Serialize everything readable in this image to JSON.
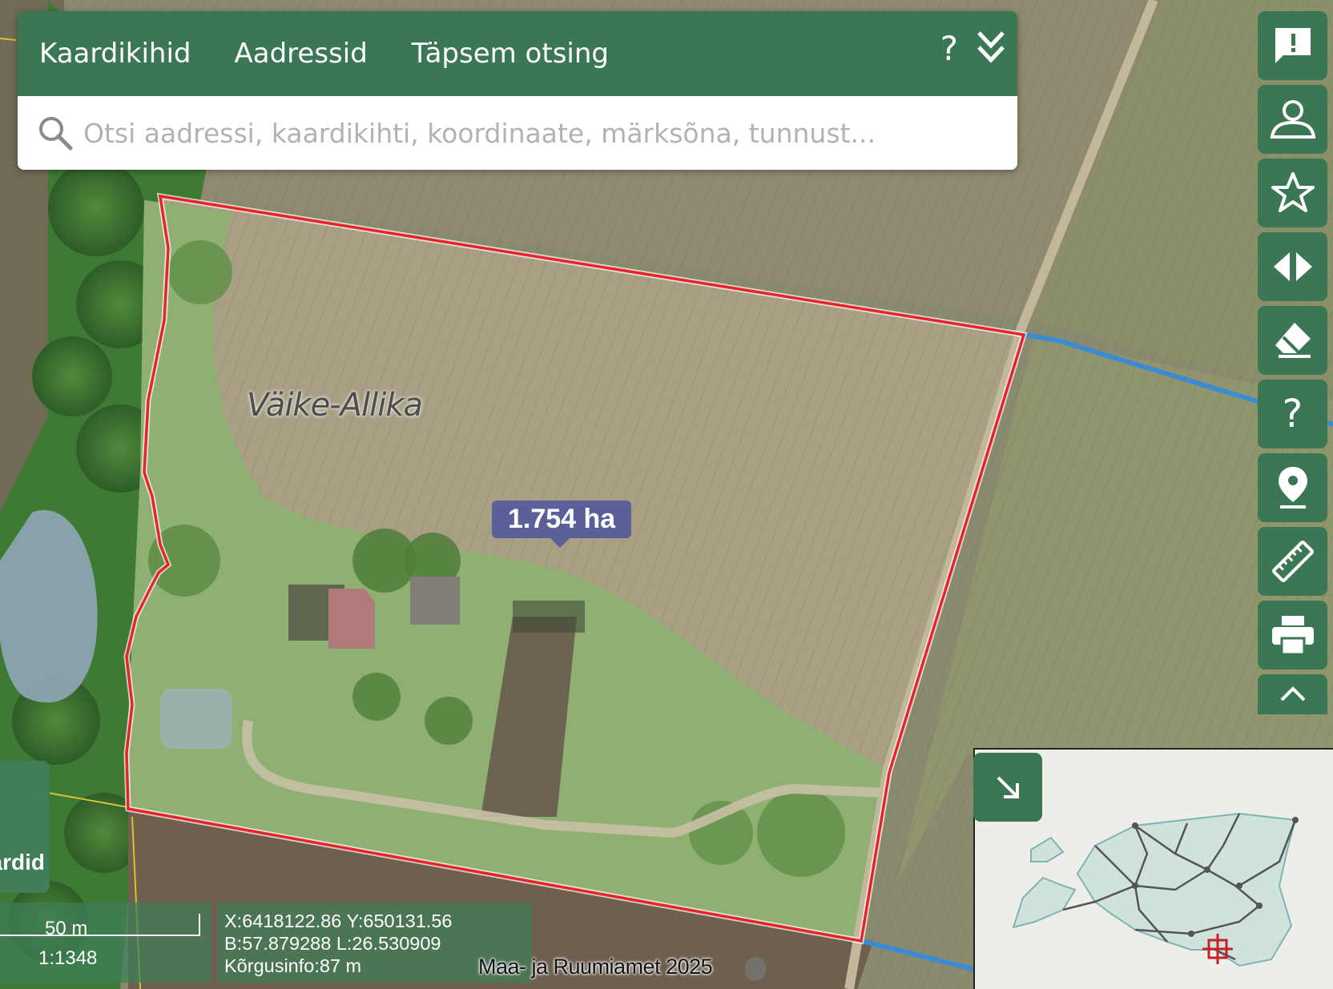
{
  "tabs": [
    "Kaardikihid",
    "Aadressid",
    "Täpsem otsing"
  ],
  "header_help": "?",
  "search": {
    "placeholder": "Otsi aadressi, kaardikihti, koordinaate, märksõna, tunnust..."
  },
  "map": {
    "place_name": "Väike-Allika",
    "area_label": "1.754 ha",
    "colors": {
      "parcel_border": "#e8242b",
      "road": "#3a8ad4",
      "panel_green": "#3b7754",
      "area_label_bg": "#5b5f9a"
    }
  },
  "toolbar": {
    "items": [
      {
        "icon": "feedback-icon"
      },
      {
        "icon": "user-icon"
      },
      {
        "icon": "star-icon"
      },
      {
        "icon": "compare-icon"
      },
      {
        "icon": "eraser-icon"
      },
      {
        "icon": "help-icon",
        "label": "?"
      },
      {
        "icon": "location-pin-icon"
      },
      {
        "icon": "ruler-icon"
      },
      {
        "icon": "print-icon"
      },
      {
        "icon": "chevron-up-icon"
      }
    ]
  },
  "left_panel": {
    "label": "ardid"
  },
  "scale": {
    "distance": "50 m",
    "ratio": "1:1348"
  },
  "coordinates": {
    "xy": "X:6418122.86 Y:650131.56",
    "bl": "B:57.879288 L:26.530909",
    "elevation": "Kõrgusinfo:87 m"
  },
  "attribution": "Maa- ja Ruumiamet 2025"
}
